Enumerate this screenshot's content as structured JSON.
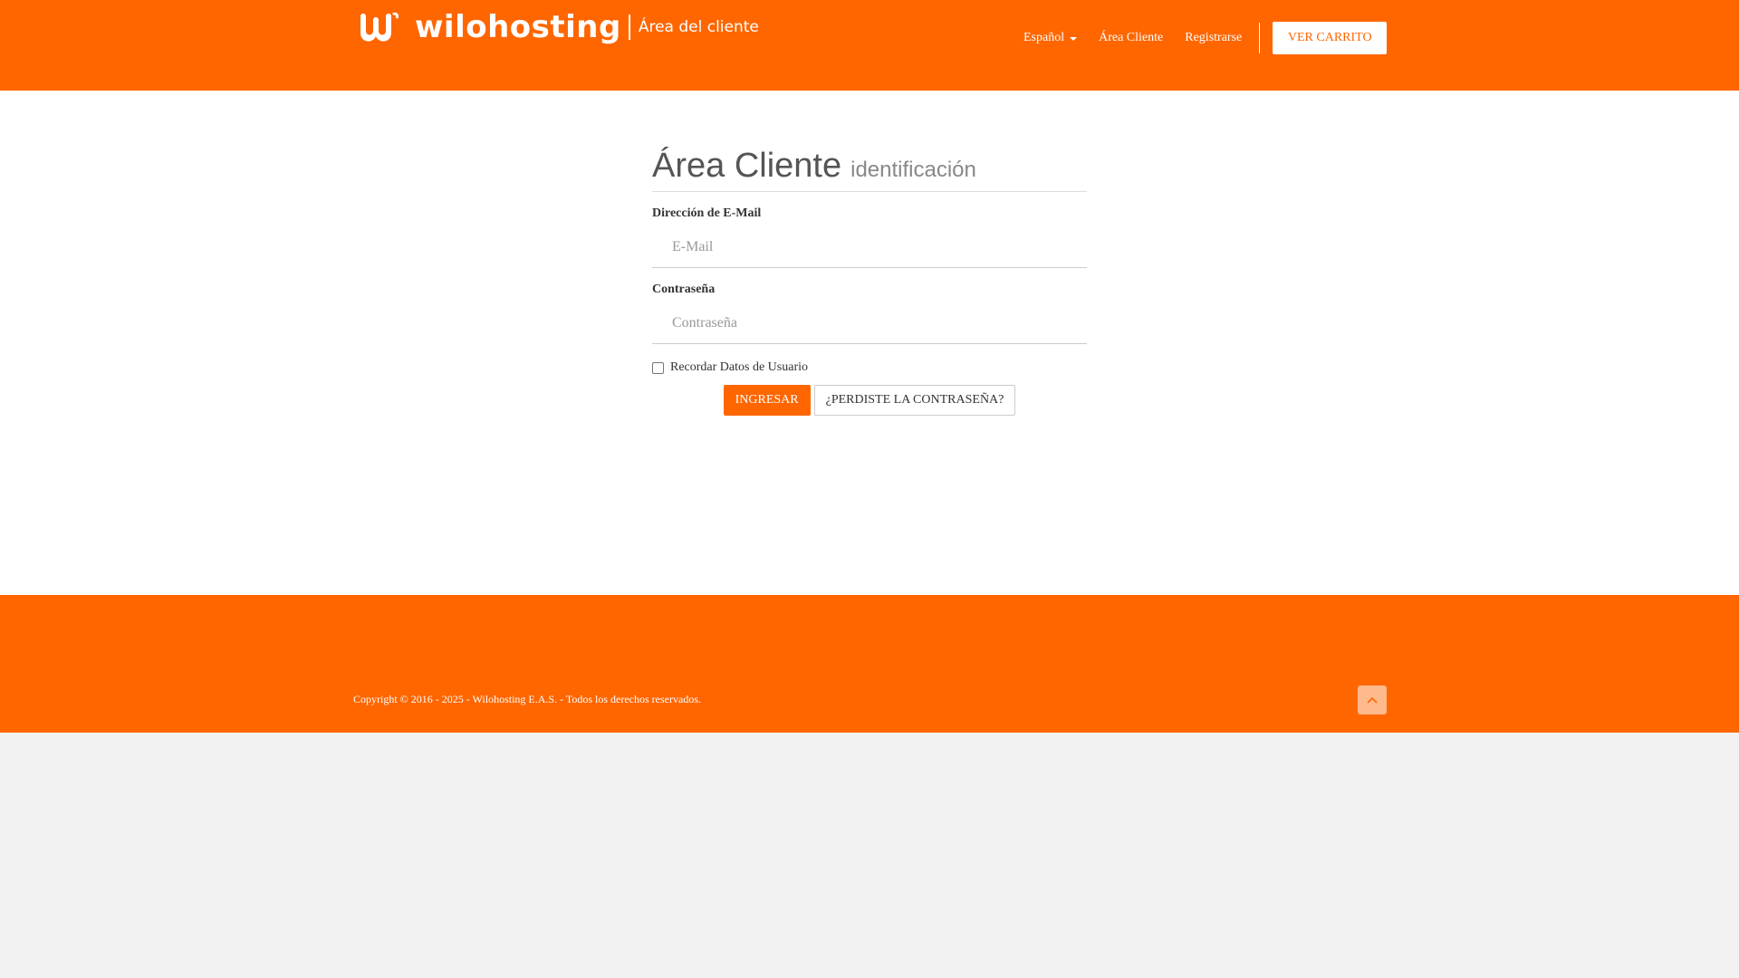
{
  "colors": {
    "brand": "#ff6600",
    "white": "#ffffff",
    "page_bg": "#f2f2f2"
  },
  "header": {
    "logo_text": "wilohosting",
    "logo_subtitle": "Área del cliente",
    "nav": {
      "language": "Español",
      "client_area": "Área Cliente",
      "register": "Registrarse",
      "cart_button": "VER CARRITO"
    },
    "icons": {
      "language_dropdown": "caret-down-icon",
      "logo_mark": "w-logo-icon"
    }
  },
  "login": {
    "title": "Área Cliente",
    "subtitle": "identificación",
    "email_label": "Dirección de E-Mail",
    "email_placeholder": "E-Mail",
    "email_value": "",
    "password_label": "Contraseña",
    "password_placeholder": "Contraseña",
    "password_value": "",
    "remember_label": "Recordar Datos de Usuario",
    "remember_checked": false,
    "submit_button": "INGRESAR",
    "forgot_button": "¿PERDISTE LA CONTRASEÑA?"
  },
  "footer": {
    "copyright": "Copyright © 2016 - 2025 - Wilohosting E.A.S. - Todos los derechos reservados.",
    "back_to_top_icon": "chevron-up-icon"
  }
}
